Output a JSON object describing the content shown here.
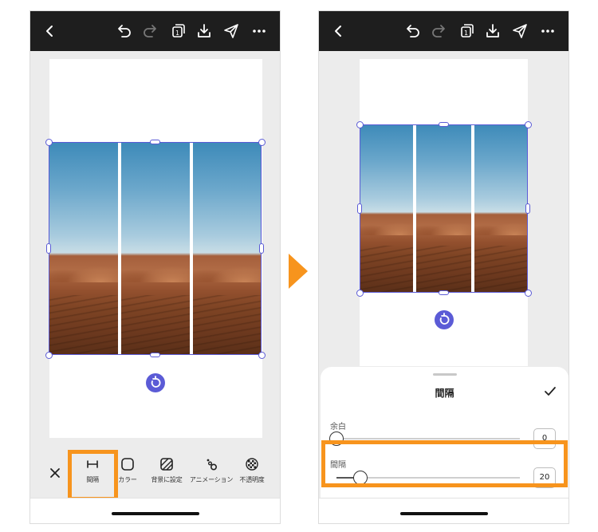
{
  "left_screen": {
    "toolbar": [
      {
        "label": "間隔",
        "icon": "spacing-icon"
      },
      {
        "label": "カラー",
        "icon": "color-icon"
      },
      {
        "label": "背景に設定",
        "icon": "set-background-icon"
      },
      {
        "label": "アニメーション",
        "icon": "animation-icon"
      },
      {
        "label": "不透明度",
        "icon": "opacity-icon"
      }
    ],
    "highlighted_tool": "間隔"
  },
  "right_screen": {
    "sheet": {
      "title": "間隔",
      "sliders": [
        {
          "label": "余白",
          "value": "0",
          "fraction": 0.0
        },
        {
          "label": "間隔",
          "value": "20",
          "fraction": 0.13
        }
      ],
      "highlighted_slider": "間隔"
    }
  },
  "icons": {
    "top_bar": [
      "back-icon",
      "undo-icon",
      "redo-icon",
      "pages-icon",
      "download-icon",
      "share-icon",
      "more-icon"
    ],
    "close": "close-icon",
    "confirm": "checkmark-icon",
    "rotate": "rotate-icon"
  },
  "colors": {
    "top_bar": "#1e1e1e",
    "selection": "#5b5bd6",
    "highlight": "#f7941d"
  }
}
